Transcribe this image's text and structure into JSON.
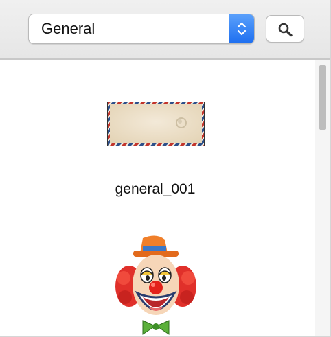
{
  "category_popup": {
    "selected": "General"
  },
  "search_button": {
    "icon": "search-icon"
  },
  "items": [
    {
      "label": "general_001",
      "thumbnail": "airmail-envelope"
    },
    {
      "label": "",
      "thumbnail": "clown-face"
    }
  ],
  "colors": {
    "accent": "#2c7bf4",
    "toolbar_bg": "#ececec",
    "scroll_thumb": "#bdbdbd"
  }
}
